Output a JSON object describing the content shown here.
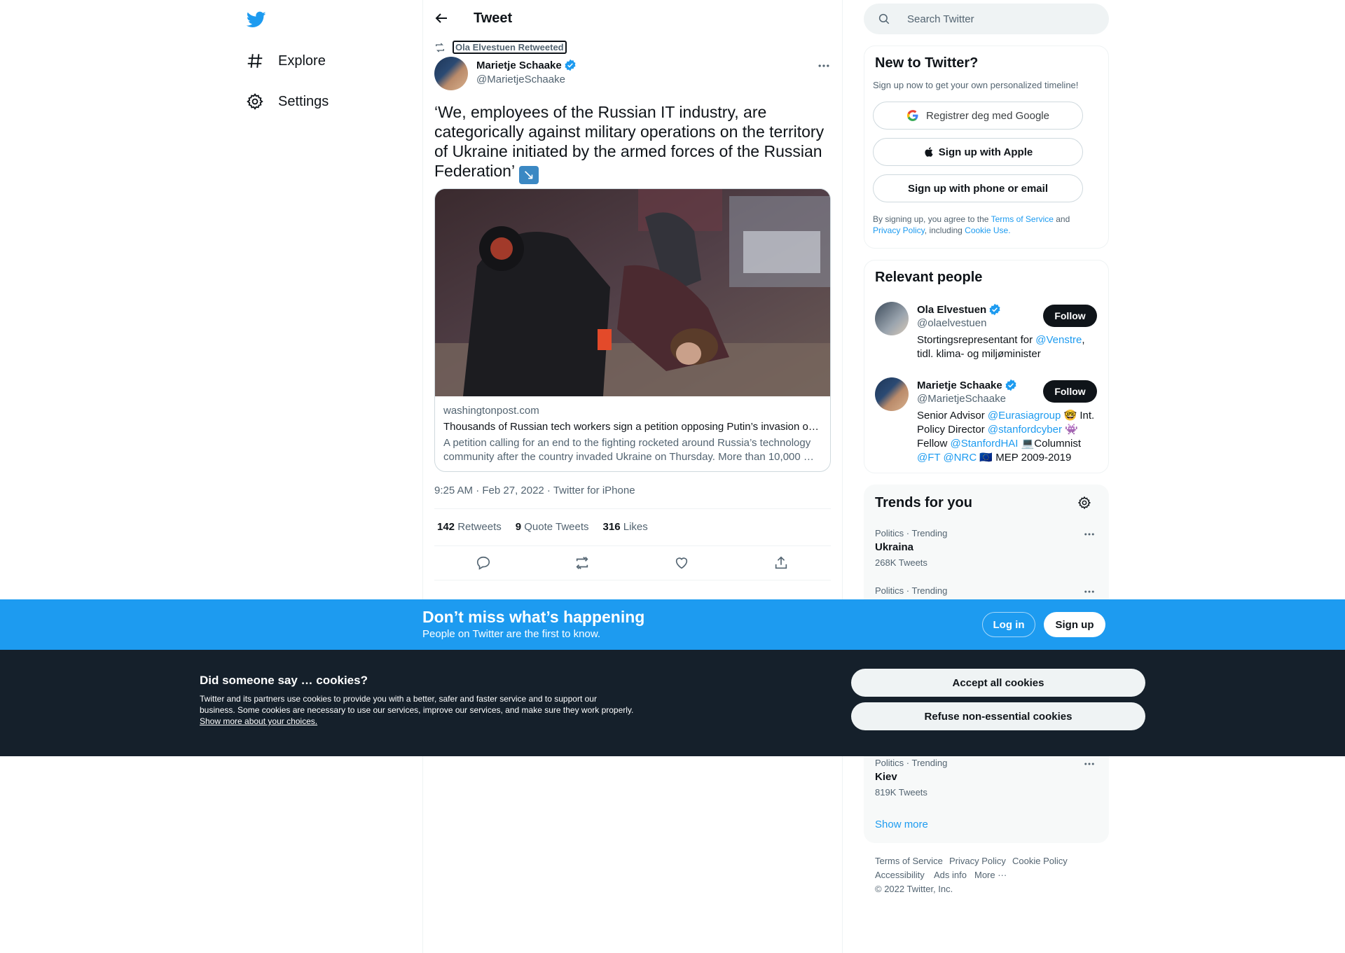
{
  "nav": {
    "explore": "Explore",
    "settings": "Settings"
  },
  "header": {
    "title": "Tweet"
  },
  "tweet": {
    "retweeted_by": "Ola Elvestuen Retweeted",
    "author_name": "Marietje Schaake",
    "author_handle": "@MarietjeSchaake",
    "text": "‘We, employees of the Russian IT industry, are categorically against military operations on the territory of Ukraine initiated by the armed forces of the Russian Federation’",
    "emoji": "↘",
    "card": {
      "domain": "washingtonpost.com",
      "title": "Thousands of Russian tech workers sign a petition opposing Putin’s invasion of …",
      "description": "A petition calling for an end to the fighting rocketed around Russia’s technology community after the country invaded Ukraine on Thursday. More than 10,000 …"
    },
    "meta": "9:25 AM · Feb 27, 2022 · Twitter for iPhone",
    "stats": {
      "retweets_count": "142",
      "retweets_label": "Retweets",
      "quotes_count": "9",
      "quotes_label": "Quote Tweets",
      "likes_count": "316",
      "likes_label": "Likes"
    }
  },
  "search": {
    "placeholder": "Search Twitter"
  },
  "signup_panel": {
    "title": "New to Twitter?",
    "subtitle": "Sign up now to get your own personalized timeline!",
    "google": "Registrer deg med Google",
    "apple": "Sign up with Apple",
    "phone": "Sign up with phone or email",
    "legal_1": "By signing up, you agree to the ",
    "terms": "Terms of Service",
    "legal_2": " and",
    "privacy": "Privacy Policy",
    "legal_3": ", including ",
    "cookie_use": "Cookie Use."
  },
  "relevant": {
    "title": "Relevant people",
    "follow": "Follow",
    "people": [
      {
        "name": "Ola Elvestuen",
        "handle": "@olaelvestuen",
        "bio_1": "Stortingsrepresentant for ",
        "bio_link": "@Venstre",
        "bio_2": ", tidl. klima- og miljøminister"
      },
      {
        "name": "Marietje Schaake",
        "handle": "@MarietjeSchaake",
        "bio_1": "Senior Advisor ",
        "bio_link1": "@Eurasiagroup",
        "bio_2": " 🤓 Int. Policy Director ",
        "bio_link2": "@stanfordcyber",
        "bio_3": " 👾 Fellow ",
        "bio_link3": "@StanfordHAI",
        "bio_4": " 💻Columnist ",
        "bio_link4": "@FT",
        "bio_link5": "@NRC",
        "bio_5": " 🇪🇺 MEP 2009-2019"
      }
    ]
  },
  "trends": {
    "title": "Trends for you",
    "items": [
      {
        "meta": "Politics · Trending",
        "name": "Ukraina",
        "count": "268K Tweets"
      },
      {
        "meta": "Politics · Trending",
        "name": "",
        "count": ""
      },
      {
        "meta": "Politics · Trending",
        "name": "Kiev",
        "count": "819K Tweets"
      }
    ],
    "show_more": "Show more"
  },
  "footer": {
    "terms": "Terms of Service",
    "privacy": "Privacy Policy",
    "cookie": "Cookie Policy",
    "accessibility": "Accessibility",
    "ads": "Ads info",
    "more": "More ···",
    "copyright": "© 2022 Twitter, Inc."
  },
  "banner": {
    "title": "Don’t miss what’s happening",
    "subtitle": "People on Twitter are the first to know.",
    "login": "Log in",
    "signup": "Sign up"
  },
  "cookies": {
    "title": "Did someone say … cookies?",
    "text": "Twitter and its partners use cookies to provide you with a better, safer and faster service and to support our business. Some cookies are necessary to use our services, improve our services, and make sure they work properly. ",
    "link": "Show more about your choices.",
    "accept": "Accept all cookies",
    "refuse": "Refuse non-essential cookies"
  },
  "colors": {
    "accent": "#1d9bf0",
    "text": "#0f1419",
    "secondary": "#536471",
    "cookie_bg": "#15202b"
  }
}
